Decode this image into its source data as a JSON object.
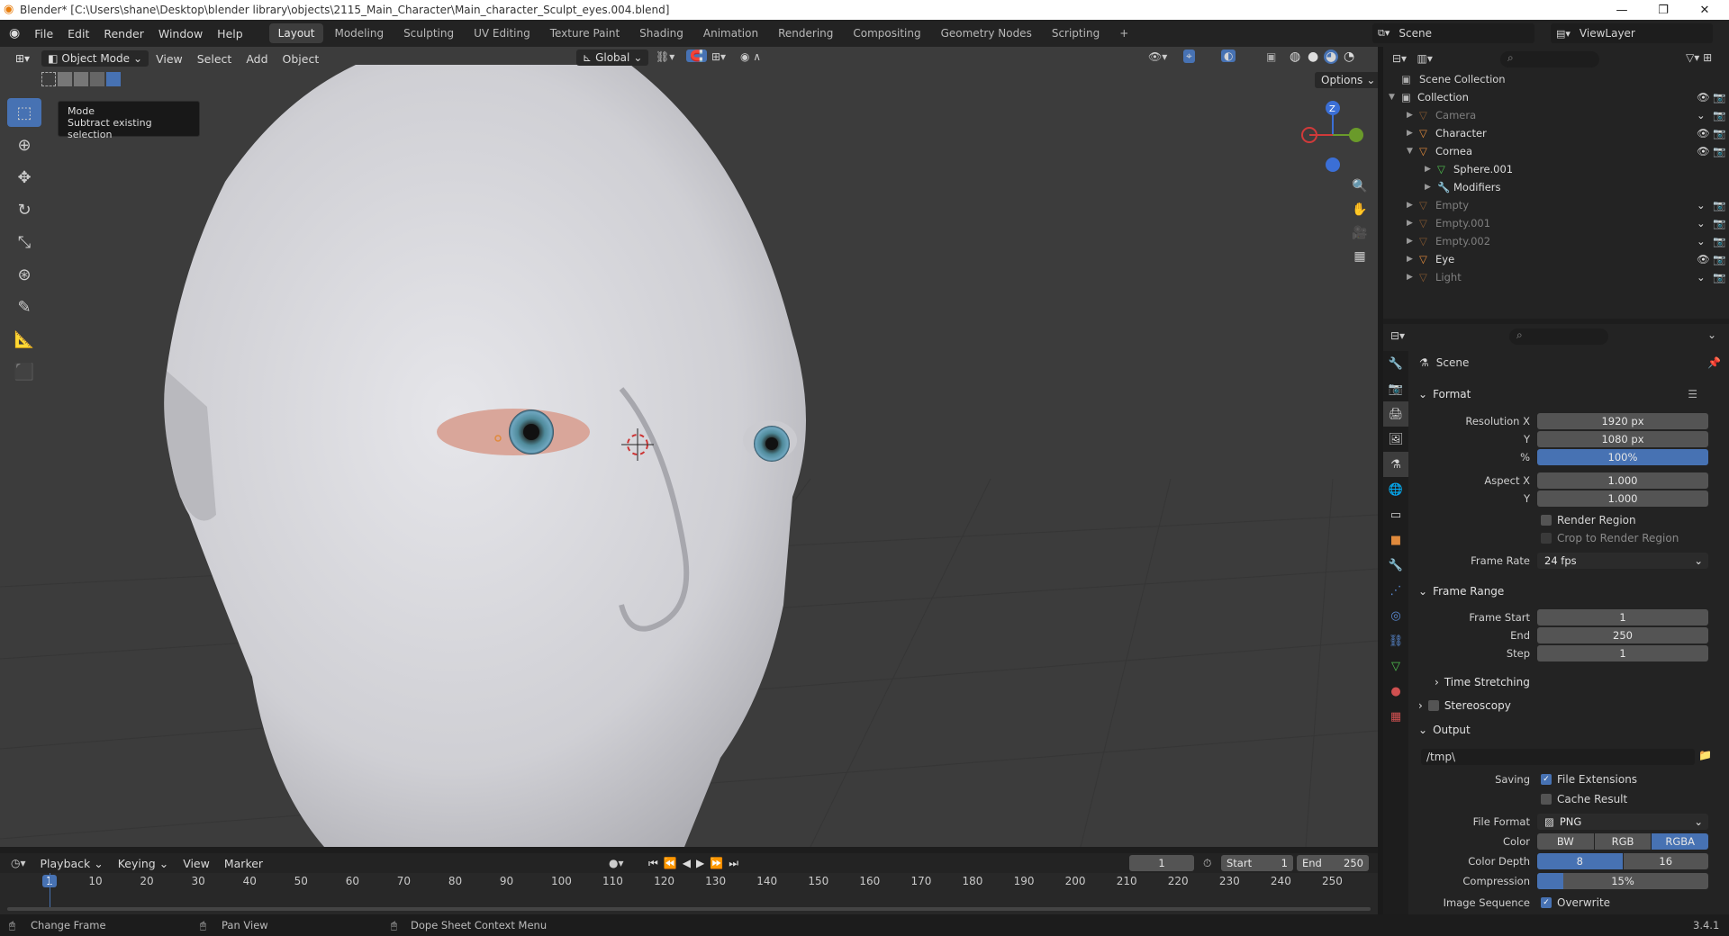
{
  "title_bar": {
    "title": "Blender* [C:\\Users\\shane\\Desktop\\blender library\\objects\\2115_Main_Character\\Main_character_Sculpt_eyes.004.blend]",
    "minimize": "—",
    "maximize": "❐",
    "close": "✕"
  },
  "menus": [
    "File",
    "Edit",
    "Render",
    "Window",
    "Help"
  ],
  "workspaces": [
    "Layout",
    "Modeling",
    "Sculpting",
    "UV Editing",
    "Texture Paint",
    "Shading",
    "Animation",
    "Rendering",
    "Compositing",
    "Geometry Nodes",
    "Scripting",
    "+"
  ],
  "active_workspace": "Layout",
  "scene_selector": "Scene",
  "view_layer": "ViewLayer",
  "viewport": {
    "mode": "Object Mode",
    "menu_items": [
      "View",
      "Select",
      "Add",
      "Object"
    ],
    "orientation": "Global",
    "options_label": "Options",
    "tooltip_title": "Mode",
    "tooltip_desc": "Subtract existing selection",
    "gizmo_z": "Z"
  },
  "outliner": {
    "root": "Scene Collection",
    "items": [
      {
        "label": "Collection",
        "type": "collection",
        "level": 0
      },
      {
        "label": "Camera",
        "type": "object",
        "level": 1,
        "dim": true
      },
      {
        "label": "Character",
        "type": "object",
        "level": 1,
        "dim": false
      },
      {
        "label": "Cornea",
        "type": "object",
        "level": 1,
        "dim": false
      },
      {
        "label": "Sphere.001",
        "type": "mesh",
        "level": 2,
        "dim": false
      },
      {
        "label": "Modifiers",
        "type": "modifier",
        "level": 2,
        "dim": false
      },
      {
        "label": "Empty",
        "type": "object",
        "level": 1,
        "dim": true
      },
      {
        "label": "Empty.001",
        "type": "object",
        "level": 1,
        "dim": true
      },
      {
        "label": "Empty.002",
        "type": "object",
        "level": 1,
        "dim": true
      },
      {
        "label": "Eye",
        "type": "object",
        "level": 1,
        "dim": false
      },
      {
        "label": "Light",
        "type": "object",
        "level": 1,
        "dim": true
      }
    ]
  },
  "properties": {
    "context": "Scene",
    "format": {
      "header": "Format",
      "resolution_x_label": "Resolution X",
      "resolution_x": "1920 px",
      "y_label": "Y",
      "resolution_y": "1080 px",
      "pct_label": "%",
      "resolution_pct": "100%",
      "aspect_x_label": "Aspect X",
      "aspect_x": "1.000",
      "aspect_y": "1.000",
      "render_region": "Render Region",
      "crop_region": "Crop to Render Region",
      "frame_rate_label": "Frame Rate",
      "frame_rate": "24 fps"
    },
    "frame_range": {
      "header": "Frame Range",
      "start_label": "Frame Start",
      "start": "1",
      "end_label": "End",
      "end": "250",
      "step_label": "Step",
      "step": "1"
    },
    "time_stretching": "Time Stretching",
    "stereoscopy": "Stereoscopy",
    "output": {
      "header": "Output",
      "path": "/tmp\\",
      "saving_label": "Saving",
      "file_extensions": "File Extensions",
      "cache_result": "Cache Result",
      "file_format_label": "File Format",
      "file_format": "PNG",
      "color_label": "Color",
      "color_options": [
        "BW",
        "RGB",
        "RGBA"
      ],
      "color_selected": "RGBA",
      "color_depth_label": "Color Depth",
      "color_depth_options": [
        "8",
        "16"
      ],
      "color_depth_selected": "8",
      "compression_label": "Compression",
      "compression": "15%",
      "compression_value": 0.15,
      "image_sequence_label": "Image Sequence",
      "overwrite": "Overwrite"
    }
  },
  "timeline": {
    "menus": [
      "Playback",
      "Keying",
      "View",
      "Marker"
    ],
    "current_frame": "1",
    "start_label": "Start",
    "start": "1",
    "end_label": "End",
    "end": "250",
    "ticks": [
      "1",
      "10",
      "20",
      "30",
      "40",
      "50",
      "60",
      "70",
      "80",
      "90",
      "100",
      "110",
      "120",
      "130",
      "140",
      "150",
      "160",
      "170",
      "180",
      "190",
      "200",
      "210",
      "220",
      "230",
      "240",
      "250"
    ]
  },
  "status_bar": {
    "left": "Change Frame",
    "middle": "Pan View",
    "right": "Dope Sheet Context Menu",
    "version": "3.4.1"
  },
  "colors": {
    "accent": "#4772b3",
    "viewport_bg": "#3c3c3c",
    "panel_bg": "#232323",
    "object_orange": "#e08a3c"
  }
}
